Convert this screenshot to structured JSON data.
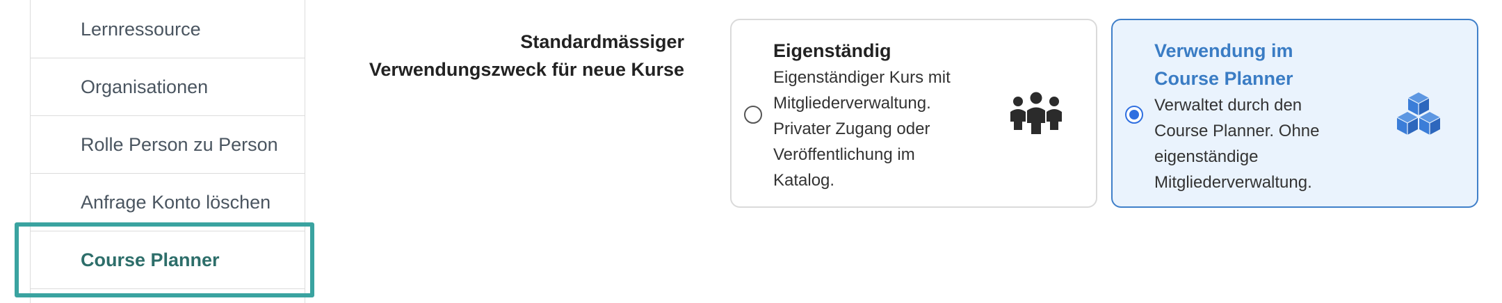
{
  "sidebar": {
    "items": [
      {
        "label": "Lernressource"
      },
      {
        "label": "Organisationen"
      },
      {
        "label": "Rolle Person zu Person"
      },
      {
        "label": "Anfrage Konto löschen"
      },
      {
        "label": "Course Planner"
      }
    ],
    "active_index": 4
  },
  "setting": {
    "label_line1": "Standardmässiger",
    "label_line2": "Verwendungszweck für neue Kurse"
  },
  "options": [
    {
      "title": "Eigenständig",
      "desc_lines": [
        "Eigenständiger Kurs mit",
        "Mitgliederverwaltung.",
        "Privater Zugang oder",
        "Veröffentlichung im",
        "Katalog."
      ],
      "icon": "group-icon",
      "selected": false
    },
    {
      "title_line1": "Verwendung im",
      "title_line2": "Course Planner",
      "desc_lines": [
        "Verwaltet durch den",
        "Course Planner. Ohne",
        "eigenständige",
        "Mitgliederverwaltung."
      ],
      "icon": "cubes-icon",
      "selected": true
    }
  ],
  "colors": {
    "accent_teal": "#3aa3a0",
    "active_text": "#2d6e6a",
    "selected_border": "#3f7fc9",
    "selected_bg": "#eaf3fd",
    "radio_blue": "#2f6fe0",
    "cube_blue": "#3b7dd8"
  }
}
